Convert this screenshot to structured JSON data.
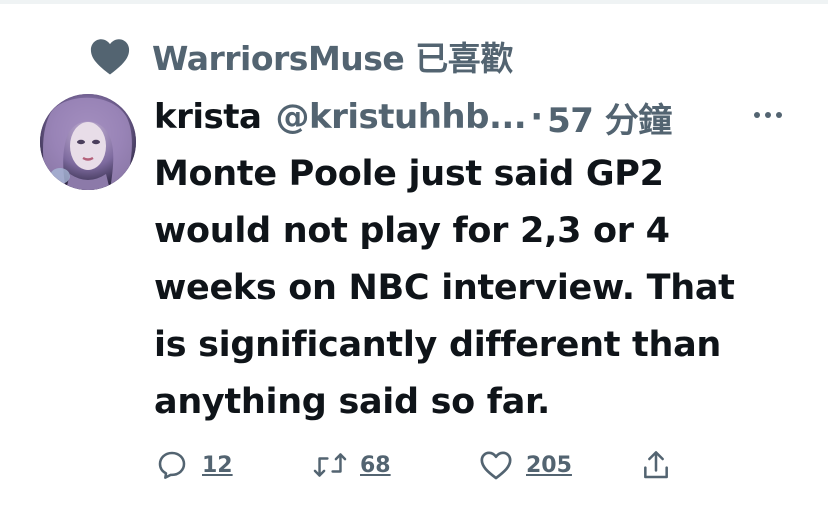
{
  "social_context": {
    "icon": "heart-filled-icon",
    "text": "WarriorsMuse 已喜歡"
  },
  "tweet": {
    "avatar": "avatar-image",
    "display_name": "krista",
    "handle": "@kristuhhb...",
    "separator": "·",
    "time": "57 分鐘",
    "more_icon": "more-icon",
    "text": "Monte Poole just said GP2\nwould not play for 2,3 or 4\nweeks on NBC interview.  That\nis significantly different than\nanything said so far."
  },
  "actions": {
    "reply": {
      "icon": "reply-icon",
      "count": "12"
    },
    "retweet": {
      "icon": "retweet-icon",
      "count": "68"
    },
    "like": {
      "icon": "like-icon",
      "count": "205"
    },
    "share": {
      "icon": "share-icon"
    }
  },
  "colors": {
    "primary_text": "#0f1419",
    "secondary_text": "#536471"
  }
}
